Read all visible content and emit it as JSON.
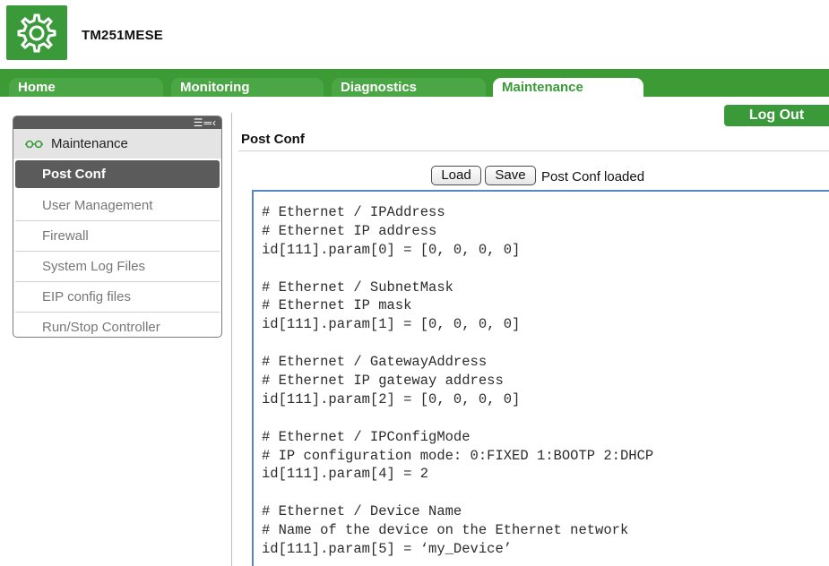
{
  "header": {
    "device_name": "TM251MESE",
    "logo_icon": "gear-icon"
  },
  "tabs": [
    {
      "label": "Home",
      "active": false
    },
    {
      "label": "Monitoring",
      "active": false
    },
    {
      "label": "Diagnostics",
      "active": false
    },
    {
      "label": "Maintenance",
      "active": true
    }
  ],
  "logout": {
    "label": "Log Out"
  },
  "sidebar": {
    "header_icon": "maintenance-icon",
    "header_title": "Maintenance",
    "items": [
      {
        "label": "Post Conf",
        "selected": true
      },
      {
        "label": "User Management",
        "selected": false
      },
      {
        "label": "Firewall",
        "selected": false
      },
      {
        "label": "System Log Files",
        "selected": false
      },
      {
        "label": "EIP config files",
        "selected": false
      },
      {
        "label": "Run/Stop Controller",
        "selected": false
      }
    ]
  },
  "main": {
    "title": "Post Conf",
    "load_label": "Load",
    "save_label": "Save",
    "status": "Post Conf loaded",
    "editor_lines": [
      "# Ethernet / IPAddress",
      "# Ethernet IP address",
      "id[111].param[0] = [0, 0, 0, 0]",
      "",
      "# Ethernet / SubnetMask",
      "# Ethernet IP mask",
      "id[111].param[1] = [0, 0, 0, 0]",
      "",
      "# Ethernet / GatewayAddress",
      "# Ethernet IP gateway address",
      "id[111].param[2] = [0, 0, 0, 0]",
      "",
      "# Ethernet / IPConfigMode",
      "# IP configuration mode: 0:FIXED 1:BOOTP 2:DHCP",
      "id[111].param[4] = 2",
      "",
      "# Ethernet / Device Name",
      "# Name of the device on the Ethernet network",
      "id[111].param[5] = ‘my_Device’"
    ]
  },
  "colors": {
    "brand_green": "#3a9a3a",
    "tab_bar": "#3d9b35",
    "editor_border": "#5a86c8",
    "sidebar_selected": "#5b5b5b"
  }
}
